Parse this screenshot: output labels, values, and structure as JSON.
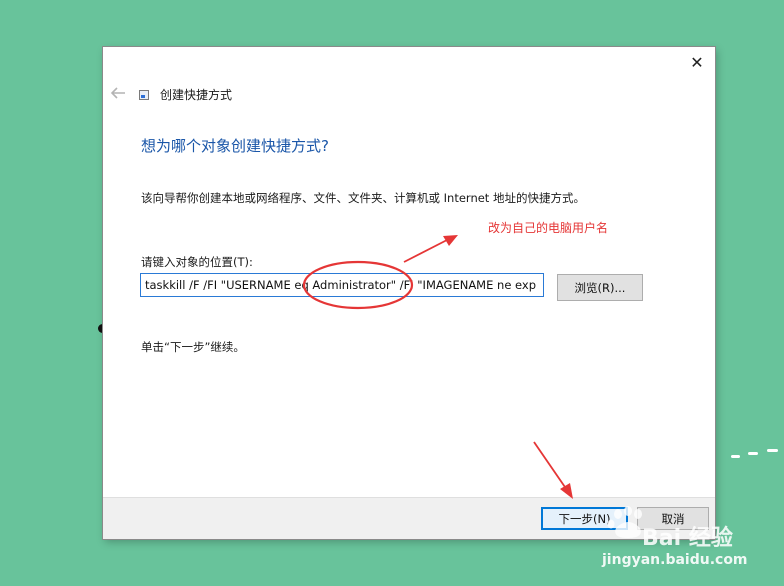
{
  "window": {
    "title": "创建快捷方式",
    "close_glyph": "✕",
    "back_icon": "back-arrow-icon"
  },
  "main": {
    "heading": "想为哪个对象创建快捷方式?",
    "description": "该向导帮你创建本地或网络程序、文件、文件夹、计算机或 Internet 地址的快捷方式。",
    "location_label": "请键入对象的位置(T):",
    "location_value": "taskkill /F /FI \"USERNAME eq Administrator\" /FI \"IMAGENAME ne exp",
    "browse_label": "浏览(R)...",
    "hint": "单击“下一步”继续。"
  },
  "footer": {
    "next_label": "下一步(N)",
    "cancel_label": "取消"
  },
  "annotation": {
    "text": "改为自己的电脑用户名",
    "color": "#e53636"
  },
  "watermark": {
    "brand": "Bai 经验",
    "url": "jingyan.baidu.com"
  },
  "colors": {
    "background": "#68c39b",
    "heading": "#1a56a8",
    "accent": "#0078d7"
  }
}
